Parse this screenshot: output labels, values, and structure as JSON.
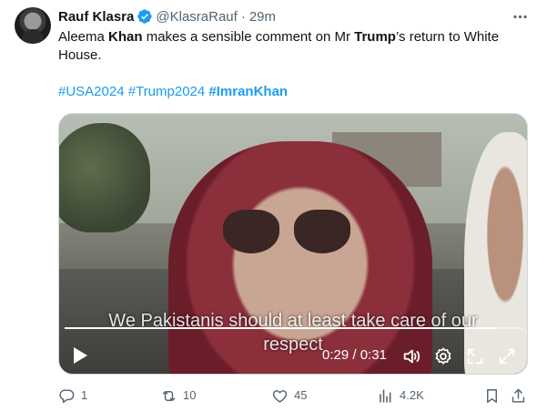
{
  "author": {
    "name": "Rauf Klasra",
    "handle": "@KlasraRauf",
    "separator": "·",
    "time": "29m"
  },
  "tweet": {
    "text_parts": [
      "Aleema ",
      "Khan",
      " makes a sensible comment on Mr ",
      "Trump",
      "’s return to White House."
    ],
    "hashtags": [
      "#USA2024",
      "#Trump2024",
      "#ImranKhan"
    ]
  },
  "video": {
    "subtitle_line1": "We Pakistanis should at least take care of our",
    "subtitle_line2": "respect",
    "current_time": "0:29",
    "time_separator": "/",
    "duration": "0:31",
    "progress_fraction": 0.94
  },
  "actions": {
    "reply_count": "1",
    "repost_count": "10",
    "like_count": "45",
    "view_count": "4.2K"
  },
  "colors": {
    "accent": "#1d9bf0",
    "secondary_text": "#536471",
    "primary_text": "#0f1419"
  },
  "icons": [
    "verified-badge-icon",
    "more-icon",
    "play-icon",
    "volume-icon",
    "settings-icon",
    "popout-icon",
    "fullscreen-icon",
    "reply-icon",
    "repost-icon",
    "like-icon",
    "views-icon",
    "bookmark-icon",
    "share-icon"
  ]
}
